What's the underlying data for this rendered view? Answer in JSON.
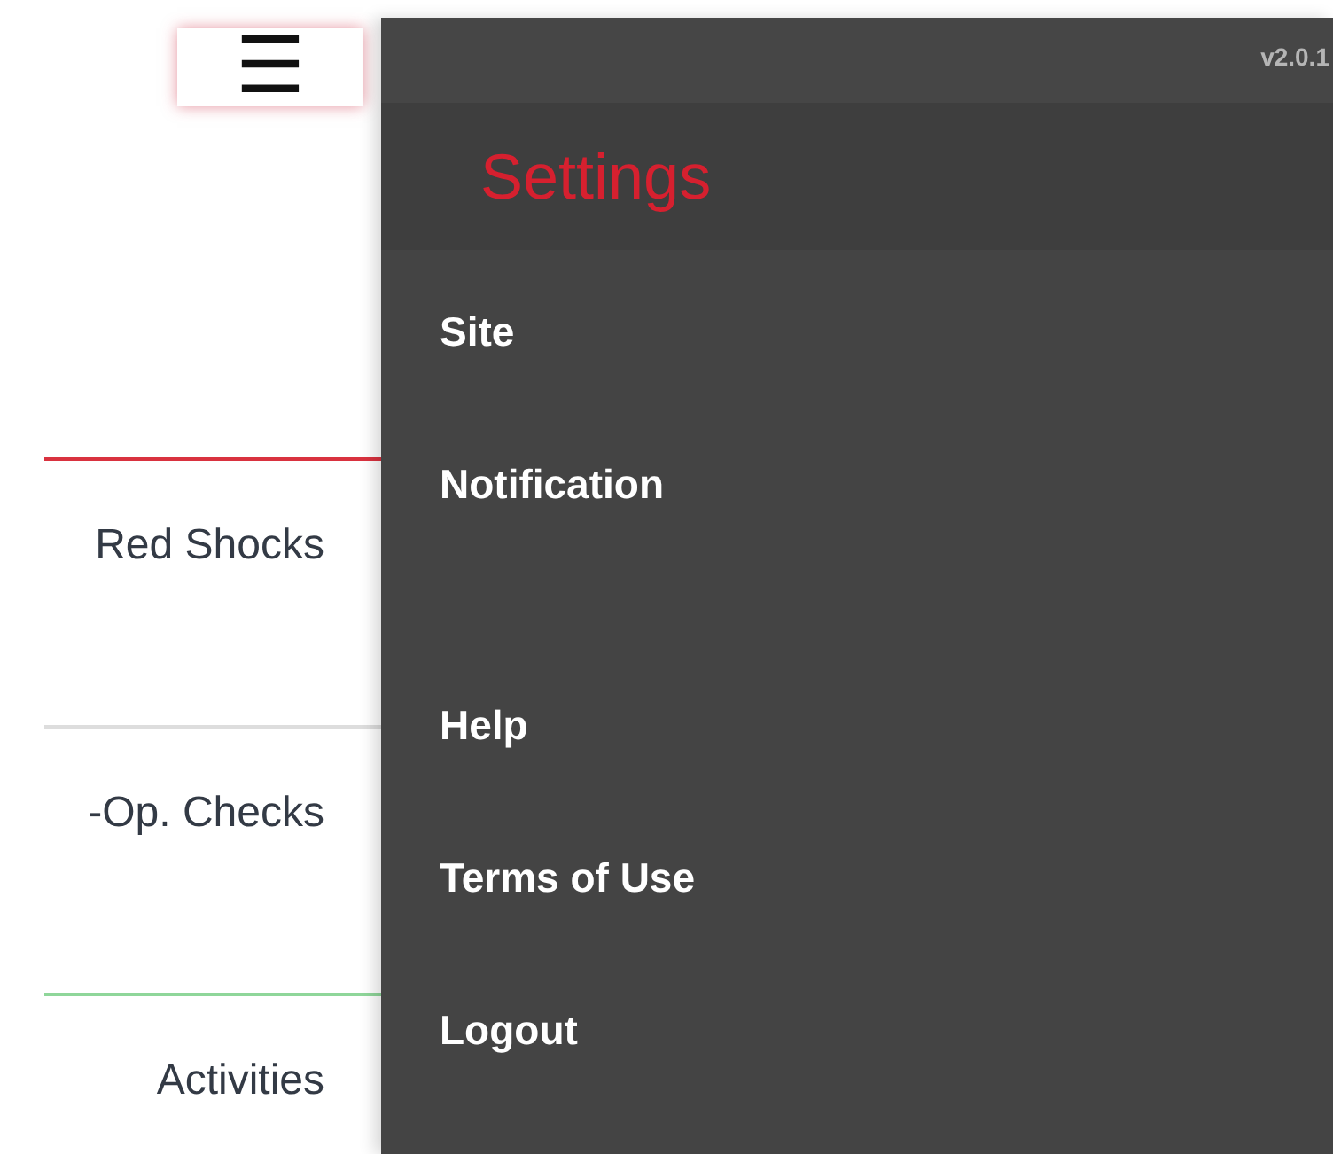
{
  "menu_button": {
    "icon": "☰"
  },
  "cards": [
    {
      "label": "Red Shocks",
      "color": "#d9323f"
    },
    {
      "label": "-Op. Checks",
      "color": "#dddddd"
    },
    {
      "label": "Activities",
      "color": "#8fd69a"
    }
  ],
  "panel": {
    "version": "v2.0.1",
    "title": "Settings",
    "sections": [
      {
        "items": [
          "Site",
          "Notification"
        ]
      },
      {
        "items": [
          "Help",
          "Terms of Use",
          "Logout"
        ]
      }
    ]
  }
}
